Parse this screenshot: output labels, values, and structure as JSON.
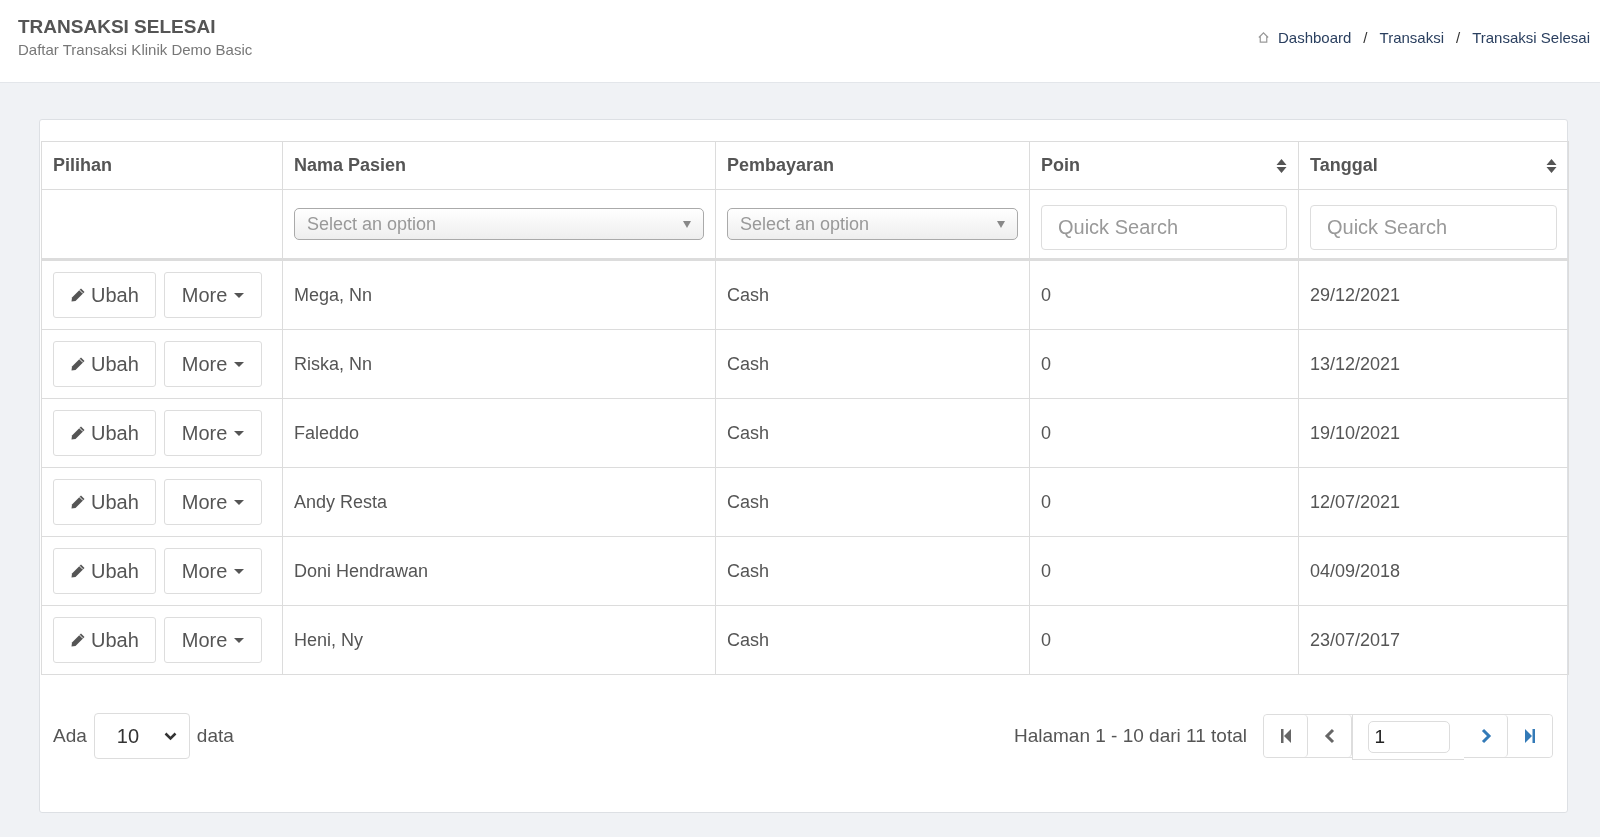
{
  "header": {
    "title": "TRANSAKSI SELESAI",
    "subtitle": "Daftar Transaksi Klinik Demo Basic"
  },
  "breadcrumb": {
    "items": [
      "Dashboard",
      "Transaksi",
      "Transaksi Selesai"
    ],
    "separators": [
      "/",
      "/"
    ]
  },
  "table": {
    "columns": [
      {
        "label": "Pilihan",
        "sortable": false
      },
      {
        "label": "Nama Pasien",
        "sortable": false
      },
      {
        "label": "Pembayaran",
        "sortable": false
      },
      {
        "label": "Poin",
        "sortable": true
      },
      {
        "label": "Tanggal",
        "sortable": true
      }
    ],
    "filters": [
      {
        "kind": "none"
      },
      {
        "kind": "select",
        "placeholder": "Select an option"
      },
      {
        "kind": "select",
        "placeholder": "Select an option"
      },
      {
        "kind": "search",
        "placeholder": "Quick Search"
      },
      {
        "kind": "search",
        "placeholder": "Quick Search"
      }
    ],
    "rows": [
      {
        "cells": [
          {
            "edit": "Ubah",
            "more": "More"
          },
          "Mega, Nn",
          "Cash",
          "0",
          "29/12/2021"
        ]
      },
      {
        "cells": [
          {
            "edit": "Ubah",
            "more": "More"
          },
          "Riska, Nn",
          "Cash",
          "0",
          "13/12/2021"
        ]
      },
      {
        "cells": [
          {
            "edit": "Ubah",
            "more": "More"
          },
          "Faleddo",
          "Cash",
          "0",
          "19/10/2021"
        ]
      },
      {
        "cells": [
          {
            "edit": "Ubah",
            "more": "More"
          },
          "Andy Resta",
          "Cash",
          "0",
          "12/07/2021"
        ]
      },
      {
        "cells": [
          {
            "edit": "Ubah",
            "more": "More"
          },
          "Doni Hendrawan",
          "Cash",
          "0",
          "04/09/2018"
        ]
      },
      {
        "cells": [
          {
            "edit": "Ubah",
            "more": "More"
          },
          "Heni, Ny",
          "Cash",
          "0",
          "23/07/2017"
        ]
      }
    ]
  },
  "footer": {
    "prefix": "Ada",
    "page_size": "10",
    "suffix": "data",
    "summary": "Halaman 1 - 10 dari 11 total",
    "pager": [
      {
        "kind": "first",
        "disabled": true
      },
      {
        "kind": "prev",
        "disabled": true
      },
      {
        "kind": "page",
        "value": "1"
      },
      {
        "kind": "next",
        "disabled": false
      },
      {
        "kind": "last",
        "disabled": false
      }
    ]
  }
}
